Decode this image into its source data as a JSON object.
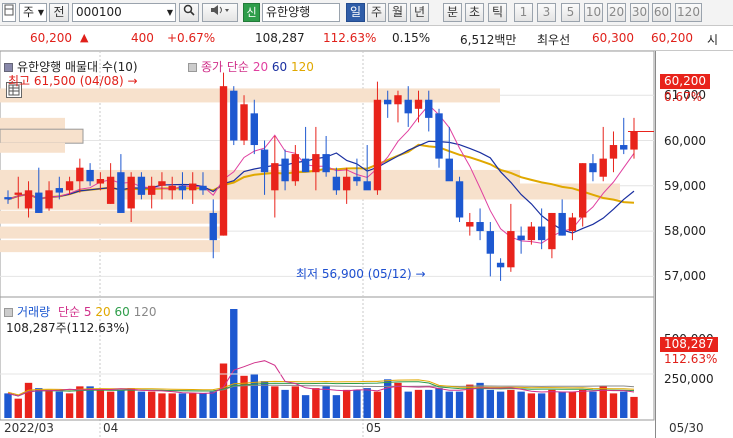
{
  "toolbar": {
    "period": "주",
    "nav_label": "전",
    "stock_code": "000100",
    "sin_badge": "신",
    "stock_name": "유한양행",
    "period_tabs": [
      {
        "label": "일",
        "active": true
      },
      {
        "label": "주",
        "active": false
      },
      {
        "label": "월",
        "active": false
      },
      {
        "label": "년",
        "active": false
      },
      {
        "label": "분",
        "active": false
      },
      {
        "label": "초",
        "active": false
      },
      {
        "label": "틱",
        "active": false
      }
    ],
    "intervals": [
      "1",
      "3",
      "5",
      "10",
      "20",
      "30",
      "60",
      "120"
    ]
  },
  "quote": {
    "price": "60,200",
    "change_arrow": "▲",
    "change": "400",
    "change_pct": "+0.67%",
    "volume": "108,287",
    "volume_ratio": "112.63%",
    "turnover": "0.15%",
    "amount": "6,512백만",
    "best_ask_label": "최우선",
    "best_ask": "60,300",
    "best_bid": "60,200",
    "market_label": "시"
  },
  "price_panel": {
    "stock_legend": "유한양행 매물대 수(10)",
    "ma_legend": {
      "title": "종가 단순",
      "p20": "20",
      "p60": "60",
      "p120": "120"
    },
    "high_label": "최고 61,500 (04/08)",
    "low_label": "최저 56,900 (05/12)",
    "current_price": "60,200",
    "current_pct": "0.67%",
    "y_ticks": [
      "61,000",
      "60,000",
      "59,000",
      "58,000",
      "57,000"
    ]
  },
  "volume_panel": {
    "legend_title": "거래량",
    "legend_ma": "단순",
    "p5": "5",
    "p20": "20",
    "p60": "60",
    "p120": "120",
    "current": "108,287주(112.63%)",
    "y_ticks": [
      "500,000",
      "250,000"
    ],
    "current_value": "108,287",
    "current_pct": "112.63%"
  },
  "x_axis": {
    "labels": [
      "2022/03",
      "04",
      "05",
      "05/30"
    ]
  },
  "colors": {
    "up": "#e8231b",
    "down": "#1d58d0",
    "ma20": "#e040a0",
    "ma60": "#1a2fa0",
    "ma120": "#e0a800",
    "profile": "#f7e1cc"
  },
  "chart_data": {
    "type": "candlestick",
    "price_range": [
      56500,
      61800
    ],
    "candles": [
      {
        "o": 58750,
        "h": 58900,
        "l": 58600,
        "c": 58700
      },
      {
        "o": 58800,
        "h": 59200,
        "l": 58500,
        "c": 58850
      },
      {
        "o": 58500,
        "h": 59100,
        "l": 58300,
        "c": 58900
      },
      {
        "o": 58850,
        "h": 59400,
        "l": 58400,
        "c": 58400
      },
      {
        "o": 58500,
        "h": 59100,
        "l": 58450,
        "c": 58900
      },
      {
        "o": 58950,
        "h": 59200,
        "l": 58700,
        "c": 58850
      },
      {
        "o": 58900,
        "h": 59200,
        "l": 58800,
        "c": 59100
      },
      {
        "o": 59100,
        "h": 59600,
        "l": 58850,
        "c": 59400
      },
      {
        "o": 59350,
        "h": 59500,
        "l": 59000,
        "c": 59100
      },
      {
        "o": 59050,
        "h": 59300,
        "l": 58900,
        "c": 59150
      },
      {
        "o": 58600,
        "h": 59500,
        "l": 58600,
        "c": 59200
      },
      {
        "o": 59300,
        "h": 59700,
        "l": 58400,
        "c": 58400
      },
      {
        "o": 58500,
        "h": 59300,
        "l": 58200,
        "c": 59200
      },
      {
        "o": 59200,
        "h": 59300,
        "l": 58700,
        "c": 58800
      },
      {
        "o": 58800,
        "h": 59200,
        "l": 58500,
        "c": 59000
      },
      {
        "o": 59000,
        "h": 59300,
        "l": 58700,
        "c": 59100
      },
      {
        "o": 58900,
        "h": 59200,
        "l": 58700,
        "c": 59000
      },
      {
        "o": 59000,
        "h": 59300,
        "l": 58700,
        "c": 58900
      },
      {
        "o": 58900,
        "h": 59300,
        "l": 58600,
        "c": 59050
      },
      {
        "o": 59000,
        "h": 59300,
        "l": 58800,
        "c": 58900
      },
      {
        "o": 58400,
        "h": 58700,
        "l": 57400,
        "c": 57800
      },
      {
        "o": 57900,
        "h": 61500,
        "l": 57900,
        "c": 61200
      },
      {
        "o": 61100,
        "h": 61200,
        "l": 59900,
        "c": 60000
      },
      {
        "o": 60000,
        "h": 61000,
        "l": 59900,
        "c": 60800
      },
      {
        "o": 60600,
        "h": 60900,
        "l": 59700,
        "c": 59900
      },
      {
        "o": 59800,
        "h": 60000,
        "l": 58800,
        "c": 59300
      },
      {
        "o": 58900,
        "h": 60100,
        "l": 58300,
        "c": 59500
      },
      {
        "o": 59600,
        "h": 59800,
        "l": 58900,
        "c": 59100
      },
      {
        "o": 59100,
        "h": 59900,
        "l": 59000,
        "c": 59700
      },
      {
        "o": 59600,
        "h": 60300,
        "l": 59400,
        "c": 59300
      },
      {
        "o": 59300,
        "h": 60300,
        "l": 58900,
        "c": 59700
      },
      {
        "o": 59700,
        "h": 60100,
        "l": 59200,
        "c": 59300
      },
      {
        "o": 59200,
        "h": 59400,
        "l": 58800,
        "c": 58900
      },
      {
        "o": 58900,
        "h": 59400,
        "l": 58600,
        "c": 59200
      },
      {
        "o": 59200,
        "h": 59600,
        "l": 59000,
        "c": 59100
      },
      {
        "o": 59100,
        "h": 59900,
        "l": 59000,
        "c": 58900
      },
      {
        "o": 58900,
        "h": 61300,
        "l": 58800,
        "c": 60900
      },
      {
        "o": 60900,
        "h": 61100,
        "l": 60500,
        "c": 60800
      },
      {
        "o": 60800,
        "h": 61100,
        "l": 60400,
        "c": 61000
      },
      {
        "o": 60900,
        "h": 61200,
        "l": 60300,
        "c": 60600
      },
      {
        "o": 60700,
        "h": 61100,
        "l": 60400,
        "c": 60900
      },
      {
        "o": 60900,
        "h": 61100,
        "l": 60200,
        "c": 60500
      },
      {
        "o": 60600,
        "h": 60700,
        "l": 59400,
        "c": 59600
      },
      {
        "o": 59600,
        "h": 60300,
        "l": 59400,
        "c": 59100
      },
      {
        "o": 59100,
        "h": 59200,
        "l": 58200,
        "c": 58300
      },
      {
        "o": 58100,
        "h": 58400,
        "l": 57900,
        "c": 58200
      },
      {
        "o": 58200,
        "h": 58500,
        "l": 57800,
        "c": 58000
      },
      {
        "o": 58000,
        "h": 58200,
        "l": 57000,
        "c": 57500
      },
      {
        "o": 57300,
        "h": 57400,
        "l": 56900,
        "c": 57200
      },
      {
        "o": 57200,
        "h": 58600,
        "l": 57100,
        "c": 58000
      },
      {
        "o": 57900,
        "h": 58100,
        "l": 57500,
        "c": 57800
      },
      {
        "o": 57800,
        "h": 58200,
        "l": 57700,
        "c": 58100
      },
      {
        "o": 58100,
        "h": 58500,
        "l": 57600,
        "c": 57800
      },
      {
        "o": 57600,
        "h": 58400,
        "l": 57400,
        "c": 58400
      },
      {
        "o": 58400,
        "h": 58700,
        "l": 57900,
        "c": 57900
      },
      {
        "o": 58000,
        "h": 58400,
        "l": 57800,
        "c": 58300
      },
      {
        "o": 58300,
        "h": 59500,
        "l": 58100,
        "c": 59500
      },
      {
        "o": 59500,
        "h": 59700,
        "l": 59100,
        "c": 59300
      },
      {
        "o": 59200,
        "h": 60300,
        "l": 59100,
        "c": 59600
      },
      {
        "o": 59600,
        "h": 60200,
        "l": 59300,
        "c": 59900
      },
      {
        "o": 59900,
        "h": 60500,
        "l": 59700,
        "c": 59800
      },
      {
        "o": 59800,
        "h": 60500,
        "l": 59600,
        "c": 60200
      }
    ],
    "volume": [
      140,
      110,
      200,
      170,
      160,
      150,
      140,
      180,
      180,
      160,
      150,
      160,
      170,
      150,
      150,
      140,
      140,
      140,
      140,
      140,
      150,
      310,
      620,
      240,
      250,
      210,
      180,
      160,
      180,
      130,
      170,
      180,
      130,
      160,
      160,
      170,
      150,
      220,
      200,
      150,
      160,
      160,
      170,
      150,
      150,
      190,
      200,
      160,
      150,
      160,
      150,
      140,
      140,
      160,
      150,
      150,
      160,
      150,
      180,
      140,
      150,
      120
    ],
    "volume_range": [
      0,
      620000
    ]
  }
}
